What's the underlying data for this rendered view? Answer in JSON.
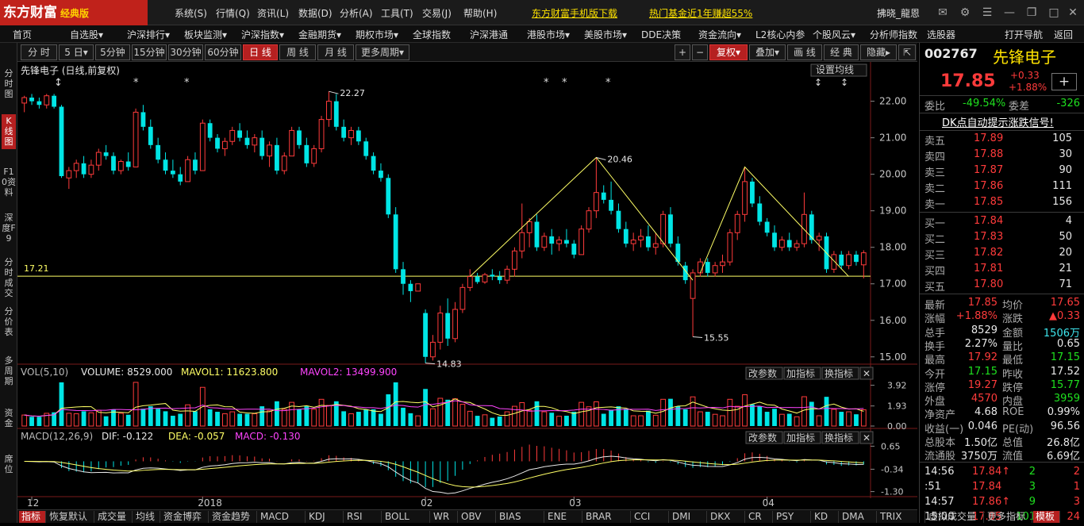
{
  "title_bar": {
    "logo": "东方财富",
    "logo_sub": "经典版",
    "menus": [
      "系统(S)",
      "行情(Q)",
      "资讯(L)",
      "数据(D)",
      "分析(A)",
      "工具(T)",
      "交易(J)",
      "帮助(H)"
    ],
    "link1": "东方财富手机版下载",
    "link2": "热门基金近1年赚超55%",
    "user": "拂晓_龍恩"
  },
  "menu_bar": [
    "首页",
    "自选股▾",
    "沪深排行▾",
    "板块监测▾",
    "沪深指数▾",
    "金融期货▾",
    "期权市场▾",
    "全球指数",
    "沪深港通",
    "港股市场▾",
    "美股市场▾",
    "DDE决策",
    "资金流向▾",
    "L2核心内参",
    "个股风云▾",
    "分析师指数",
    "选股器",
    "打开导航",
    "返回"
  ],
  "left_nav": [
    {
      "label": "分时图",
      "active": false
    },
    {
      "label": "K线图",
      "active": true
    },
    {
      "label": "F10资料",
      "active": false
    },
    {
      "label": "深度F9",
      "active": false
    },
    {
      "label": "分时成交",
      "active": false
    },
    {
      "label": "分价表",
      "active": false
    },
    {
      "label": "多周期",
      "active": false
    },
    {
      "label": "资金",
      "active": false
    },
    {
      "label": "席位",
      "active": false
    }
  ],
  "toolbar": {
    "periods": [
      "分 时",
      "5 日▾",
      "5分钟",
      "15分钟",
      "30分钟",
      "60分钟",
      "日 线",
      "周 线",
      "月 线",
      "更多周期▾"
    ],
    "active_period": "日 线",
    "right": [
      "+",
      "−",
      "复权▾",
      "叠加▾",
      "画 线",
      "经 典",
      "隐藏▸",
      "⇱"
    ]
  },
  "chart_data": {
    "type": "candlestick",
    "title": "先锋电子 (日线,前复权)",
    "ma_button": "设置均线",
    "y_ticks": [
      "22.00",
      "21.00",
      "20.00",
      "19.00",
      "18.00",
      "17.00",
      "16.00",
      "15.00"
    ],
    "ylim": [
      14.8,
      22.6
    ],
    "x_ticks": [
      "12",
      "2018",
      "02",
      "03",
      "04"
    ],
    "hline_value": 17.21,
    "hline_label": "17.21",
    "annotations": [
      {
        "label": "22.27",
        "value": 22.27
      },
      {
        "label": "20.46",
        "value": 20.46
      },
      {
        "label": "15.55",
        "value": 15.55
      },
      {
        "label": "14.83",
        "value": 14.83
      }
    ],
    "candles": [
      [
        21.95,
        22.15,
        21.7,
        22.1
      ],
      [
        22.1,
        22.2,
        21.9,
        22.0
      ],
      [
        22.0,
        22.1,
        21.8,
        21.9
      ],
      [
        21.9,
        22.2,
        21.8,
        22.15
      ],
      [
        22.15,
        22.2,
        21.8,
        21.85
      ],
      [
        21.85,
        21.9,
        19.9,
        19.95
      ],
      [
        19.9,
        20.2,
        19.6,
        20.1
      ],
      [
        20.1,
        20.4,
        19.9,
        20.3
      ],
      [
        20.3,
        20.5,
        19.9,
        20.0
      ],
      [
        20.0,
        20.4,
        19.9,
        20.25
      ],
      [
        20.25,
        20.7,
        20.1,
        20.6
      ],
      [
        20.6,
        20.8,
        20.4,
        20.5
      ],
      [
        20.5,
        20.6,
        20.0,
        20.1
      ],
      [
        20.1,
        20.4,
        20.0,
        20.35
      ],
      [
        20.35,
        20.6,
        20.1,
        20.2
      ],
      [
        20.2,
        21.8,
        20.2,
        21.7
      ],
      [
        21.7,
        21.9,
        21.2,
        21.3
      ],
      [
        21.3,
        21.5,
        20.7,
        20.8
      ],
      [
        20.8,
        21.0,
        20.3,
        20.4
      ],
      [
        20.4,
        20.6,
        20.0,
        20.1
      ],
      [
        20.1,
        20.4,
        19.9,
        20.0
      ],
      [
        20.0,
        20.2,
        19.7,
        19.8
      ],
      [
        19.8,
        20.5,
        19.8,
        20.4
      ],
      [
        20.4,
        20.6,
        20.0,
        20.1
      ],
      [
        20.1,
        21.5,
        20.1,
        21.4
      ],
      [
        21.4,
        21.5,
        20.9,
        21.0
      ],
      [
        21.0,
        21.1,
        20.6,
        20.7
      ],
      [
        20.7,
        21.0,
        20.5,
        20.9
      ],
      [
        20.9,
        21.3,
        20.8,
        21.2
      ],
      [
        21.2,
        21.4,
        20.9,
        21.0
      ],
      [
        21.0,
        21.2,
        20.7,
        20.8
      ],
      [
        20.8,
        21.1,
        20.6,
        21.0
      ],
      [
        21.0,
        21.2,
        20.4,
        20.5
      ],
      [
        20.5,
        20.9,
        20.2,
        20.8
      ],
      [
        20.8,
        21.0,
        20.0,
        20.1
      ],
      [
        20.1,
        20.6,
        20.0,
        20.5
      ],
      [
        20.5,
        21.3,
        20.5,
        21.2
      ],
      [
        21.2,
        21.3,
        20.7,
        20.8
      ],
      [
        20.8,
        21.0,
        20.2,
        20.3
      ],
      [
        20.3,
        20.8,
        20.2,
        20.7
      ],
      [
        20.7,
        21.6,
        20.6,
        21.5
      ],
      [
        21.5,
        22.27,
        21.3,
        22.0
      ],
      [
        22.0,
        22.2,
        21.2,
        21.3
      ],
      [
        21.3,
        21.5,
        20.9,
        21.0
      ],
      [
        21.0,
        21.3,
        20.8,
        21.2
      ],
      [
        21.2,
        21.3,
        20.8,
        20.9
      ],
      [
        20.9,
        21.0,
        20.4,
        20.5
      ],
      [
        20.5,
        20.6,
        20.0,
        20.1
      ],
      [
        20.1,
        20.3,
        19.8,
        19.9
      ],
      [
        19.9,
        20.0,
        18.8,
        18.9
      ],
      [
        18.9,
        19.1,
        17.3,
        17.4
      ],
      [
        17.4,
        17.6,
        16.7,
        17.0
      ],
      [
        17.0,
        17.1,
        16.5,
        16.8
      ],
      [
        16.8,
        17.0,
        16.9,
        17.0
      ],
      [
        16.2,
        16.3,
        14.83,
        15.0
      ],
      [
        15.0,
        15.6,
        14.9,
        15.4
      ],
      [
        15.4,
        16.4,
        15.2,
        16.2
      ],
      [
        16.2,
        16.6,
        15.3,
        15.5
      ],
      [
        15.5,
        16.5,
        15.4,
        16.3
      ],
      [
        16.3,
        17.0,
        16.2,
        16.9
      ],
      [
        16.9,
        17.4,
        16.8,
        17.2
      ],
      [
        17.2,
        17.3,
        17.0,
        17.05
      ],
      [
        17.05,
        17.3,
        17.0,
        17.25
      ],
      [
        17.25,
        17.4,
        17.1,
        17.2
      ],
      [
        17.2,
        17.35,
        17.0,
        17.1
      ],
      [
        17.1,
        17.5,
        17.0,
        17.4
      ],
      [
        17.4,
        18.0,
        17.2,
        17.9
      ],
      [
        17.9,
        19.2,
        17.7,
        18.4
      ],
      [
        18.4,
        18.8,
        18.0,
        18.7
      ],
      [
        18.7,
        18.9,
        17.9,
        18.0
      ],
      [
        18.0,
        18.4,
        17.9,
        18.3
      ],
      [
        18.3,
        18.5,
        17.8,
        18.1
      ],
      [
        18.1,
        18.3,
        17.9,
        18.2
      ],
      [
        18.2,
        18.5,
        18.0,
        18.1
      ],
      [
        18.1,
        18.2,
        17.7,
        17.8
      ],
      [
        17.8,
        18.6,
        17.8,
        18.5
      ],
      [
        18.5,
        19.1,
        18.4,
        19.0
      ],
      [
        19.0,
        20.46,
        18.8,
        19.5
      ],
      [
        19.5,
        19.7,
        19.2,
        19.3
      ],
      [
        19.3,
        19.8,
        18.9,
        19.0
      ],
      [
        19.0,
        19.2,
        18.4,
        18.5
      ],
      [
        18.5,
        18.7,
        18.0,
        18.1
      ],
      [
        18.1,
        18.4,
        17.9,
        18.2
      ],
      [
        18.2,
        18.5,
        18.0,
        18.3
      ],
      [
        18.3,
        18.6,
        17.9,
        18.0
      ],
      [
        18.0,
        18.4,
        17.8,
        18.1
      ],
      [
        18.1,
        19.0,
        18.0,
        18.9
      ],
      [
        18.9,
        19.1,
        18.0,
        18.1
      ],
      [
        18.1,
        18.3,
        17.5,
        17.6
      ],
      [
        17.5,
        17.6,
        17.0,
        17.1
      ],
      [
        16.6,
        17.4,
        15.55,
        17.3
      ],
      [
        17.3,
        17.7,
        17.2,
        17.6
      ],
      [
        17.6,
        17.7,
        17.2,
        17.3
      ],
      [
        17.3,
        17.6,
        17.2,
        17.5
      ],
      [
        17.5,
        17.8,
        17.3,
        17.6
      ],
      [
        17.6,
        18.5,
        17.5,
        18.4
      ],
      [
        18.4,
        19.0,
        18.2,
        18.9
      ],
      [
        18.9,
        20.2,
        18.7,
        19.8
      ],
      [
        19.8,
        19.9,
        19.1,
        19.2
      ],
      [
        19.2,
        19.4,
        18.6,
        18.7
      ],
      [
        18.7,
        18.8,
        18.3,
        18.4
      ],
      [
        18.4,
        18.6,
        17.9,
        18.0
      ],
      [
        18.0,
        18.3,
        17.9,
        18.2
      ],
      [
        18.2,
        18.4,
        17.9,
        18.0
      ],
      [
        18.0,
        18.2,
        17.9,
        18.1
      ],
      [
        18.1,
        19.5,
        18.0,
        18.9
      ],
      [
        18.9,
        19.0,
        18.1,
        18.2
      ],
      [
        18.2,
        18.4,
        17.9,
        18.3
      ],
      [
        18.3,
        18.4,
        17.3,
        17.4
      ],
      [
        17.4,
        17.9,
        17.3,
        17.8
      ],
      [
        17.8,
        17.9,
        17.4,
        17.5
      ],
      [
        17.5,
        17.9,
        17.4,
        17.8
      ],
      [
        17.8,
        17.9,
        17.5,
        17.6
      ],
      [
        17.52,
        17.92,
        17.15,
        17.85
      ]
    ],
    "volume_panel": {
      "title": "VOL(5,10)",
      "volume_label": "VOLUME: 8529.000",
      "mavol1_label": "MAVOL1: 11623.800",
      "mavol2_label": "MAVOL2: 13499.900",
      "y_ticks": [
        "3.92",
        "1.93",
        "0.00"
      ],
      "ymax": 4.5
    },
    "macd_panel": {
      "title": "MACD(12,26,9)",
      "dif_label": "DIF: -0.122",
      "dea_label": "DEA: -0.057",
      "macd_label": "MACD: -0.130",
      "y_ticks": [
        "0.65",
        "-0.34",
        "-1.30"
      ],
      "ylim": [
        -1.45,
        0.8
      ]
    },
    "panel_buttons": [
      "改参数",
      "加指标",
      "换指标",
      "✕"
    ]
  },
  "stock_panel": {
    "code": "002767",
    "name": "先锋电子",
    "price": "17.85",
    "change": "+0.33",
    "change_pct": "+1.88%",
    "wei_bi_label": "委比",
    "wei_bi": "-49.54%",
    "wei_cha_label": "委差",
    "wei_cha": "-326",
    "signal": "DK点自动提示涨跌信号!",
    "asks": [
      {
        "label": "卖五",
        "price": "17.89",
        "vol": "105"
      },
      {
        "label": "卖四",
        "price": "17.88",
        "vol": "30"
      },
      {
        "label": "卖三",
        "price": "17.87",
        "vol": "90"
      },
      {
        "label": "卖二",
        "price": "17.86",
        "vol": "111"
      },
      {
        "label": "卖一",
        "price": "17.85",
        "vol": "156"
      }
    ],
    "bids": [
      {
        "label": "买一",
        "price": "17.84",
        "vol": "4"
      },
      {
        "label": "买二",
        "price": "17.83",
        "vol": "50"
      },
      {
        "label": "买三",
        "price": "17.82",
        "vol": "20"
      },
      {
        "label": "买四",
        "price": "17.81",
        "vol": "21"
      },
      {
        "label": "买五",
        "price": "17.80",
        "vol": "71"
      }
    ],
    "stats": [
      {
        "l1": "最新",
        "v1": "17.85",
        "c1": "red",
        "l2": "均价",
        "v2": "17.65",
        "c2": "red"
      },
      {
        "l1": "涨幅",
        "v1": "+1.88%",
        "c1": "red",
        "l2": "涨跌",
        "v2": "▲0.33",
        "c2": "red"
      },
      {
        "l1": "总手",
        "v1": "8529",
        "c1": "wht",
        "l2": "金额",
        "v2": "1506万",
        "c2": "cyan"
      },
      {
        "l1": "换手",
        "v1": "2.27%",
        "c1": "wht",
        "l2": "量比",
        "v2": "0.65",
        "c2": "wht"
      },
      {
        "l1": "最高",
        "v1": "17.92",
        "c1": "red",
        "l2": "最低",
        "v2": "17.15",
        "c2": "grn"
      },
      {
        "l1": "今开",
        "v1": "17.15",
        "c1": "grn",
        "l2": "昨收",
        "v2": "17.52",
        "c2": "wht"
      },
      {
        "l1": "涨停",
        "v1": "19.27",
        "c1": "red",
        "l2": "跌停",
        "v2": "15.77",
        "c2": "grn"
      },
      {
        "l1": "外盘",
        "v1": "4570",
        "c1": "red",
        "l2": "内盘",
        "v2": "3959",
        "c2": "grn"
      },
      {
        "l1": "净资产",
        "v1": "4.68",
        "c1": "wht",
        "l2": "ROE",
        "v2": "0.99%",
        "c2": "wht"
      },
      {
        "l1": "收益(一)",
        "v1": "0.046",
        "c1": "wht",
        "l2": "PE(动)",
        "v2": "96.56",
        "c2": "wht"
      },
      {
        "l1": "总股本",
        "v1": "1.50亿",
        "c1": "wht",
        "l2": "总值",
        "v2": "26.8亿",
        "c2": "wht"
      },
      {
        "l1": "流通股",
        "v1": "3750万",
        "c1": "wht",
        "l2": "流值",
        "v2": "6.69亿",
        "c2": "wht"
      }
    ],
    "ticks": [
      {
        "time": "14:56",
        "price": "17.84↑",
        "vol": "2",
        "n": "2"
      },
      {
        "time": ":51",
        "price": "17.84",
        "vol": "3",
        "n": "1"
      },
      {
        "time": "14:57",
        "price": "17.86↑",
        "vol": "9",
        "n": "3"
      },
      {
        "time": "15:00",
        "price": "17.85",
        "vol": "101",
        "n": "24"
      }
    ]
  },
  "bottom_tabs": [
    "指标",
    "恢复默认",
    "成交量",
    "均线",
    "资金博弈",
    "资金趋势",
    "MACD",
    "KDJ",
    "RSI",
    "BOLL",
    "WR",
    "OBV",
    "BIAS",
    "ENE",
    "BRAR",
    "CCI",
    "DMI",
    "DKX",
    "CR",
    "PSY",
    "KD",
    "DMA",
    "TRIX",
    "虚拟成交量",
    "更多指标",
    "模板"
  ],
  "colors": {
    "up": "#ff3b3b",
    "down": "#00e5e5",
    "bg": "#000000",
    "accent": "#b52020"
  }
}
